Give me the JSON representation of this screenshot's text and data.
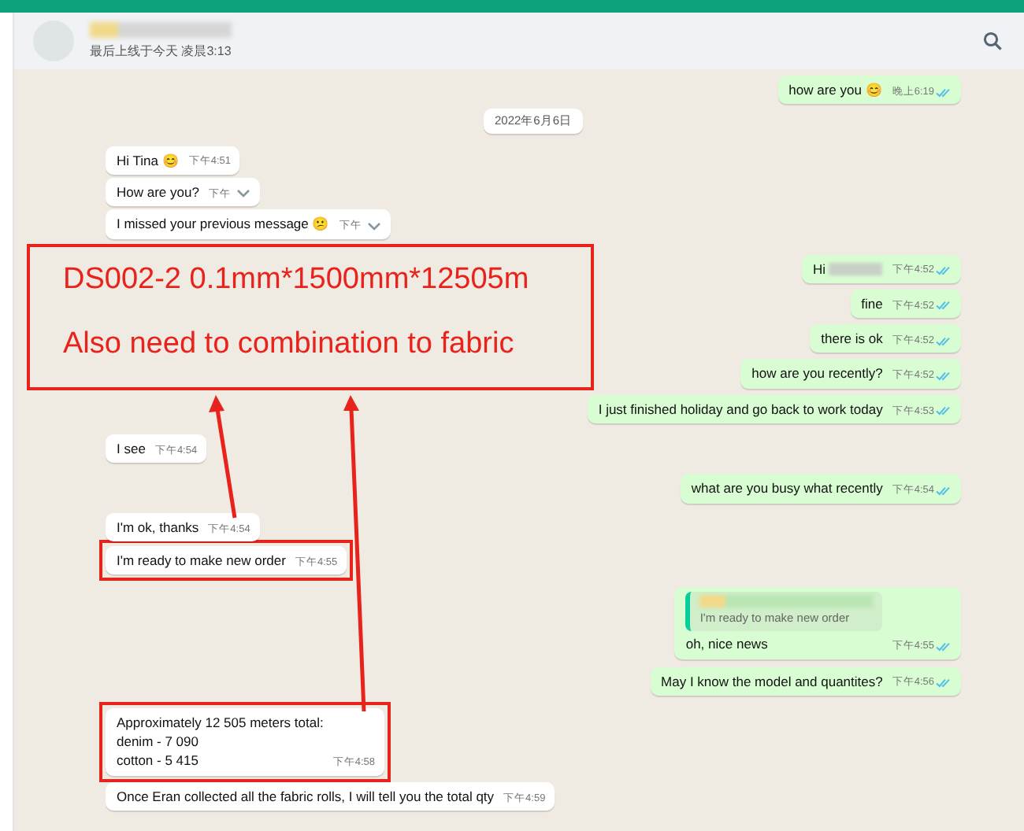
{
  "header": {
    "name_redacted": true,
    "status": "最后上线于今天 凌晨3:13"
  },
  "messages": [
    {
      "kind": "out",
      "text": "how are you 😊",
      "time": "晚上6:19",
      "read": true
    },
    {
      "kind": "date",
      "text": "2022年6月6日"
    },
    {
      "kind": "in",
      "text": "Hi Tina 😊",
      "time": "下午4:51",
      "hovered": false,
      "highlighted": false
    },
    {
      "kind": "in",
      "text": "How are you?",
      "time": "下午",
      "hovered": true,
      "highlighted": false
    },
    {
      "kind": "in",
      "text": "I missed your previous message 😕",
      "time": "下午",
      "hovered": true,
      "highlighted": false
    },
    {
      "kind": "out",
      "text": "Hi",
      "redacted": true,
      "time": "下午4:52",
      "read": true
    },
    {
      "kind": "out",
      "text": "fine",
      "time": "下午4:52",
      "read": true
    },
    {
      "kind": "out",
      "text": "there is ok",
      "time": "下午4:52",
      "read": true
    },
    {
      "kind": "out",
      "text": "how are you recently?",
      "time": "下午4:52",
      "read": true
    },
    {
      "kind": "out",
      "text": "I just finished holiday and go back to work today",
      "time": "下午4:53",
      "read": true
    },
    {
      "kind": "in",
      "text": "I see",
      "time": "下午4:54",
      "hovered": false,
      "highlighted": false
    },
    {
      "kind": "out",
      "text": "what are you busy what recently",
      "time": "下午4:54",
      "read": true
    },
    {
      "kind": "in",
      "text": "I'm ok, thanks",
      "time": "下午4:54",
      "hovered": false,
      "highlighted": false
    },
    {
      "kind": "in",
      "text": "I'm ready to make new order",
      "time": "下午4:55",
      "hovered": false,
      "highlighted": true
    },
    {
      "kind": "out",
      "quote": {
        "name_redacted": true,
        "text": "I'm ready to make new order"
      },
      "text": "oh, nice news",
      "time": "下午4:55",
      "read": true
    },
    {
      "kind": "out",
      "text": "May I know the model and quantites?",
      "time": "下午4:56",
      "read": true
    },
    {
      "kind": "in",
      "lines": [
        "Approximately 12 505 meters total:",
        "denim - 7 090",
        "cotton - 5 415"
      ],
      "time": "下午4:58",
      "hovered": false,
      "highlighted": true
    },
    {
      "kind": "in",
      "text": "Once Eran collected all the fabric rolls, I will tell you the total qty",
      "time": "下午4:59",
      "hovered": false,
      "highlighted": false
    }
  ],
  "annotation": {
    "lines": [
      "DS002-2 0.1mm*1500mm*12505m",
      "Also need to combination to fabric"
    ]
  }
}
